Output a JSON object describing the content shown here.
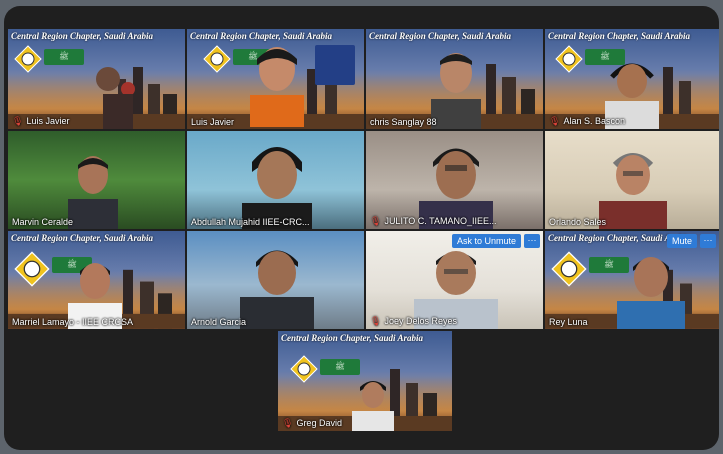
{
  "banner_text": "Central Region Chapter, Saudi Arabia",
  "colors": {
    "accent": "#2f7bd6",
    "active_outline": "#d9d47a",
    "mic_muted": "#e0453a",
    "flag_green": "#1f7a3a"
  },
  "participants": [
    {
      "name": "Luis Javier",
      "muted": true
    },
    {
      "name": "Luis Javier",
      "muted": false,
      "active": true
    },
    {
      "name": "chris Sanglay 88",
      "muted": false
    },
    {
      "name": "Alan S. Bascon",
      "muted": true
    },
    {
      "name": "Marvin Ceralde",
      "muted": false
    },
    {
      "name": "Abdullah Mujahid IIEE-CRC...",
      "muted": false
    },
    {
      "name": "JULITO C. TAMANO_IIEE...",
      "muted": true
    },
    {
      "name": "Orlando Sales",
      "muted": false
    },
    {
      "name": "Marriel Lamayo - IIEE CRCSA",
      "muted": false
    },
    {
      "name": "Arnold Garcia",
      "muted": false
    },
    {
      "name": "Joey Delos Reyes",
      "muted": true
    },
    {
      "name": "Rey Luna",
      "muted": false
    },
    {
      "name": "Greg David",
      "muted": true
    }
  ],
  "controls": {
    "ask_to_unmute": "Ask to Unmute",
    "mute": "Mute",
    "more": "···"
  },
  "icons": {
    "mic_muted": "mic-off-icon",
    "more": "more-options-icon"
  }
}
